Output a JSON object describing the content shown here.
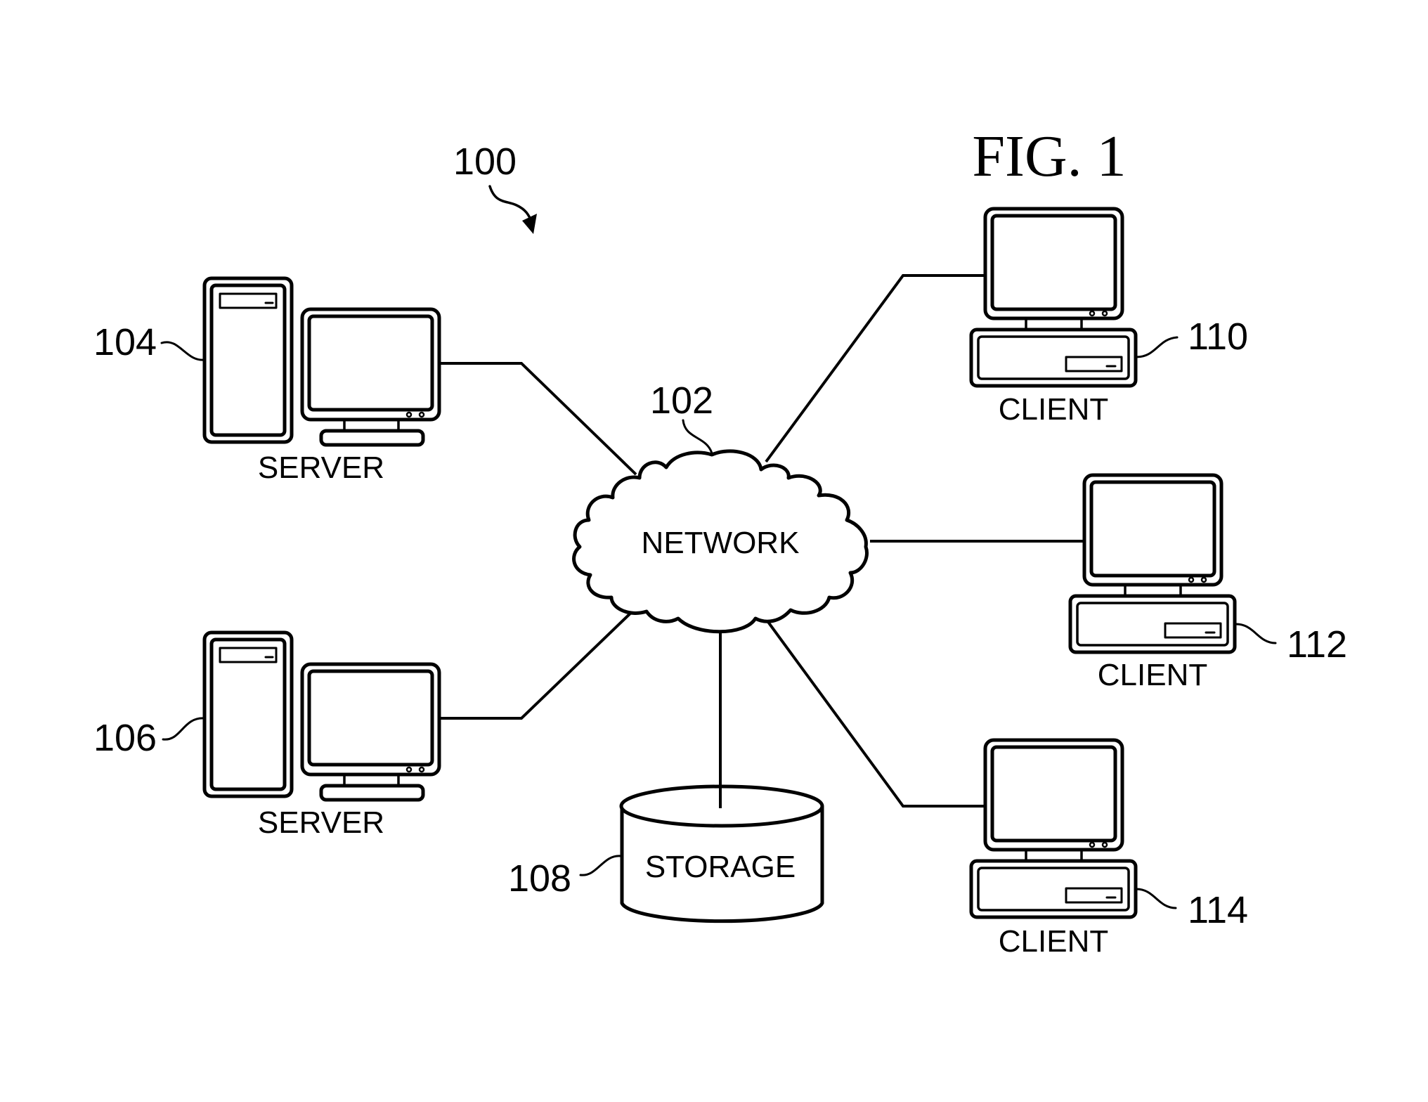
{
  "figure": {
    "title": "FIG. 1",
    "system_ref": "100"
  },
  "network": {
    "ref": "102",
    "label": "NETWORK"
  },
  "servers": [
    {
      "ref": "104",
      "label": "SERVER"
    },
    {
      "ref": "106",
      "label": "SERVER"
    }
  ],
  "storage": {
    "ref": "108",
    "label": "STORAGE"
  },
  "clients": [
    {
      "ref": "110",
      "label": "CLIENT"
    },
    {
      "ref": "112",
      "label": "CLIENT"
    },
    {
      "ref": "114",
      "label": "CLIENT"
    }
  ],
  "colors": {
    "ink": "#000000",
    "background": "#ffffff"
  }
}
